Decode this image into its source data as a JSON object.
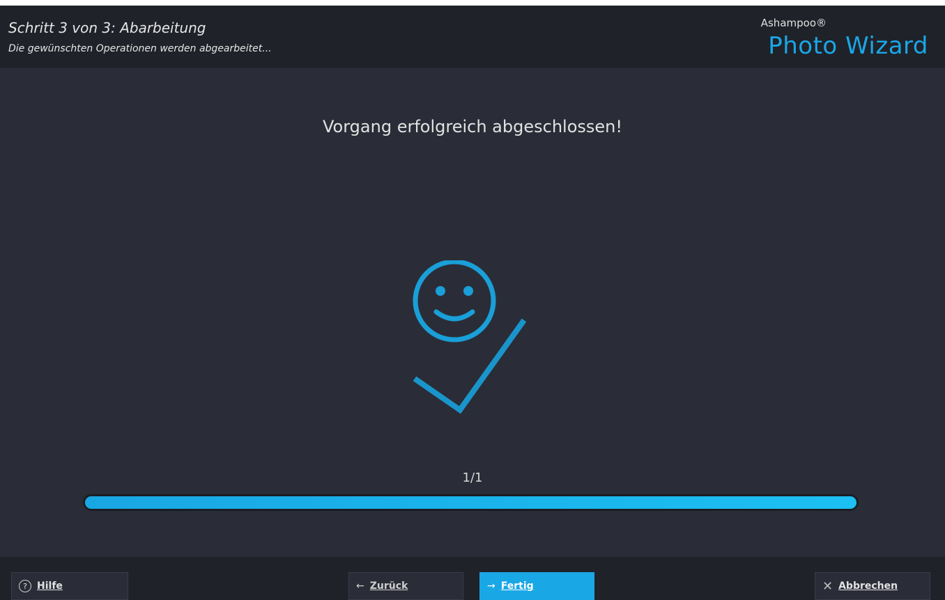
{
  "header": {
    "step_title": "Schritt 3 von 3: Abarbeitung",
    "step_subtitle": "Die gewünschten Operationen werden abgearbeitet...",
    "brand_small": "Ashampoo®",
    "brand_big": "Photo Wizard"
  },
  "main": {
    "status_title": "Vorgang erfolgreich abgeschlossen!",
    "counter": "1/1",
    "progress": 1.0,
    "illustration_icon": "smiley-check-icon"
  },
  "footer": {
    "help_label": "Hilfe",
    "back_label": "Zurück",
    "finish_label": "Fertig",
    "cancel_label": "Abbrechen"
  },
  "colors": {
    "accent": "#1aa7e6",
    "background": "#2a2d37",
    "header_bg": "#1f2229"
  }
}
